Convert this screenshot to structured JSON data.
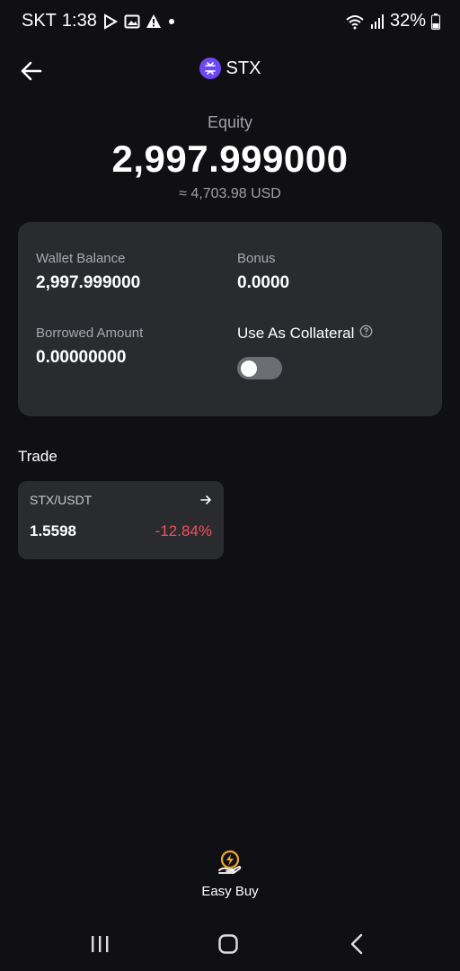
{
  "status_bar": {
    "carrier": "SKT",
    "time": "1:38",
    "battery": "32%"
  },
  "header": {
    "coin": "STX"
  },
  "equity": {
    "label": "Equity",
    "value": "2,997.999000",
    "usd": "≈ 4,703.98 USD"
  },
  "balances": {
    "wallet_label": "Wallet Balance",
    "wallet_value": "2,997.999000",
    "bonus_label": "Bonus",
    "bonus_value": "0.0000",
    "borrowed_label": "Borrowed Amount",
    "borrowed_value": "0.00000000",
    "collateral_label": "Use As Collateral",
    "collateral_on": false
  },
  "trade": {
    "title": "Trade",
    "pair": "STX/USDT",
    "price": "1.5598",
    "change": "-12.84%",
    "change_color": "#f0525a"
  },
  "bottom": {
    "easy_buy_label": "Easy Buy"
  },
  "colors": {
    "coin_logo": "#6e47f5",
    "background": "#101014",
    "card": "#2a2b2f",
    "easy_buy_accent": "#f0a830"
  }
}
